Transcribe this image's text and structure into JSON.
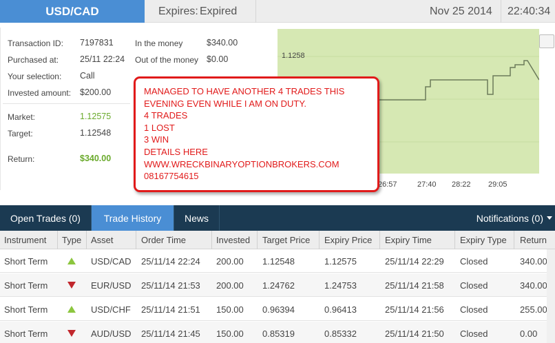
{
  "header": {
    "asset": "USD/CAD",
    "expires_label": "Expires:",
    "expires_value": "Expired",
    "date": "Nov 25 2014",
    "time": "22:40:34"
  },
  "details": {
    "transaction_id_label": "Transaction ID:",
    "transaction_id": "7197831",
    "purchased_at_label": "Purchased at:",
    "purchased_at": "25/11 22:24",
    "selection_label": "Your selection:",
    "selection": "Call",
    "invested_label": "Invested amount:",
    "invested": "$200.00",
    "in_money_label": "In the money",
    "in_money": "$340.00",
    "out_money_label": "Out of the money",
    "out_money": "$0.00",
    "market_label": "Market:",
    "market": "1.12575",
    "target_label": "Target:",
    "target": "1.12548",
    "return_label": "Return:",
    "return_value": "$340.00"
  },
  "chart": {
    "y_label": "1.1258",
    "x_ticks": [
      "26:57",
      "27:40",
      "28:22",
      "29:05"
    ],
    "plot_color": "#d6e8b3"
  },
  "annotation": {
    "lines": [
      "MANAGED TO HAVE ANOTHER 4 TRADES THIS",
      "EVENING EVEN WHILE I AM ON DUTY.",
      "4 TRADES",
      "1 LOST",
      "3 WIN",
      "DETAILS HERE",
      "WWW.WRECKBINARYOPTIONBROKERS.COM",
      "08167754615"
    ],
    "color": "#e11a1a"
  },
  "tabs": {
    "open_trades": "Open Trades (0)",
    "trade_history": "Trade History",
    "news": "News",
    "notifications": "Notifications (0)"
  },
  "table": {
    "columns": [
      "Instrument",
      "Type",
      "Asset",
      "Order Time",
      "Invested",
      "Target Price",
      "Expiry Price",
      "Expiry Time",
      "Expiry Type",
      "Return"
    ],
    "rows": [
      {
        "instrument": "Short Term",
        "type": "call",
        "asset": "USD/CAD",
        "order_time": "25/11/14 22:24",
        "invested": "200.00",
        "target": "1.12548",
        "expiry_price": "1.12575",
        "expiry_time": "25/11/14 22:29",
        "expiry_type": "Closed",
        "return": "340.00"
      },
      {
        "instrument": "Short Term",
        "type": "put",
        "asset": "EUR/USD",
        "order_time": "25/11/14 21:53",
        "invested": "200.00",
        "target": "1.24762",
        "expiry_price": "1.24753",
        "expiry_time": "25/11/14 21:58",
        "expiry_type": "Closed",
        "return": "340.00"
      },
      {
        "instrument": "Short Term",
        "type": "call",
        "asset": "USD/CHF",
        "order_time": "25/11/14 21:51",
        "invested": "150.00",
        "target": "0.96394",
        "expiry_price": "0.96413",
        "expiry_time": "25/11/14 21:56",
        "expiry_type": "Closed",
        "return": "255.00"
      },
      {
        "instrument": "Short Term",
        "type": "put",
        "asset": "AUD/USD",
        "order_time": "25/11/14 21:45",
        "invested": "150.00",
        "target": "0.85319",
        "expiry_price": "0.85332",
        "expiry_time": "25/11/14 21:50",
        "expiry_type": "Closed",
        "return": "0.00"
      }
    ]
  },
  "colors": {
    "accent": "#4a8ed4",
    "nav": "#1b3a52",
    "up": "#8cc63f",
    "down": "#c1272d",
    "positive": "#6aaa2c"
  }
}
